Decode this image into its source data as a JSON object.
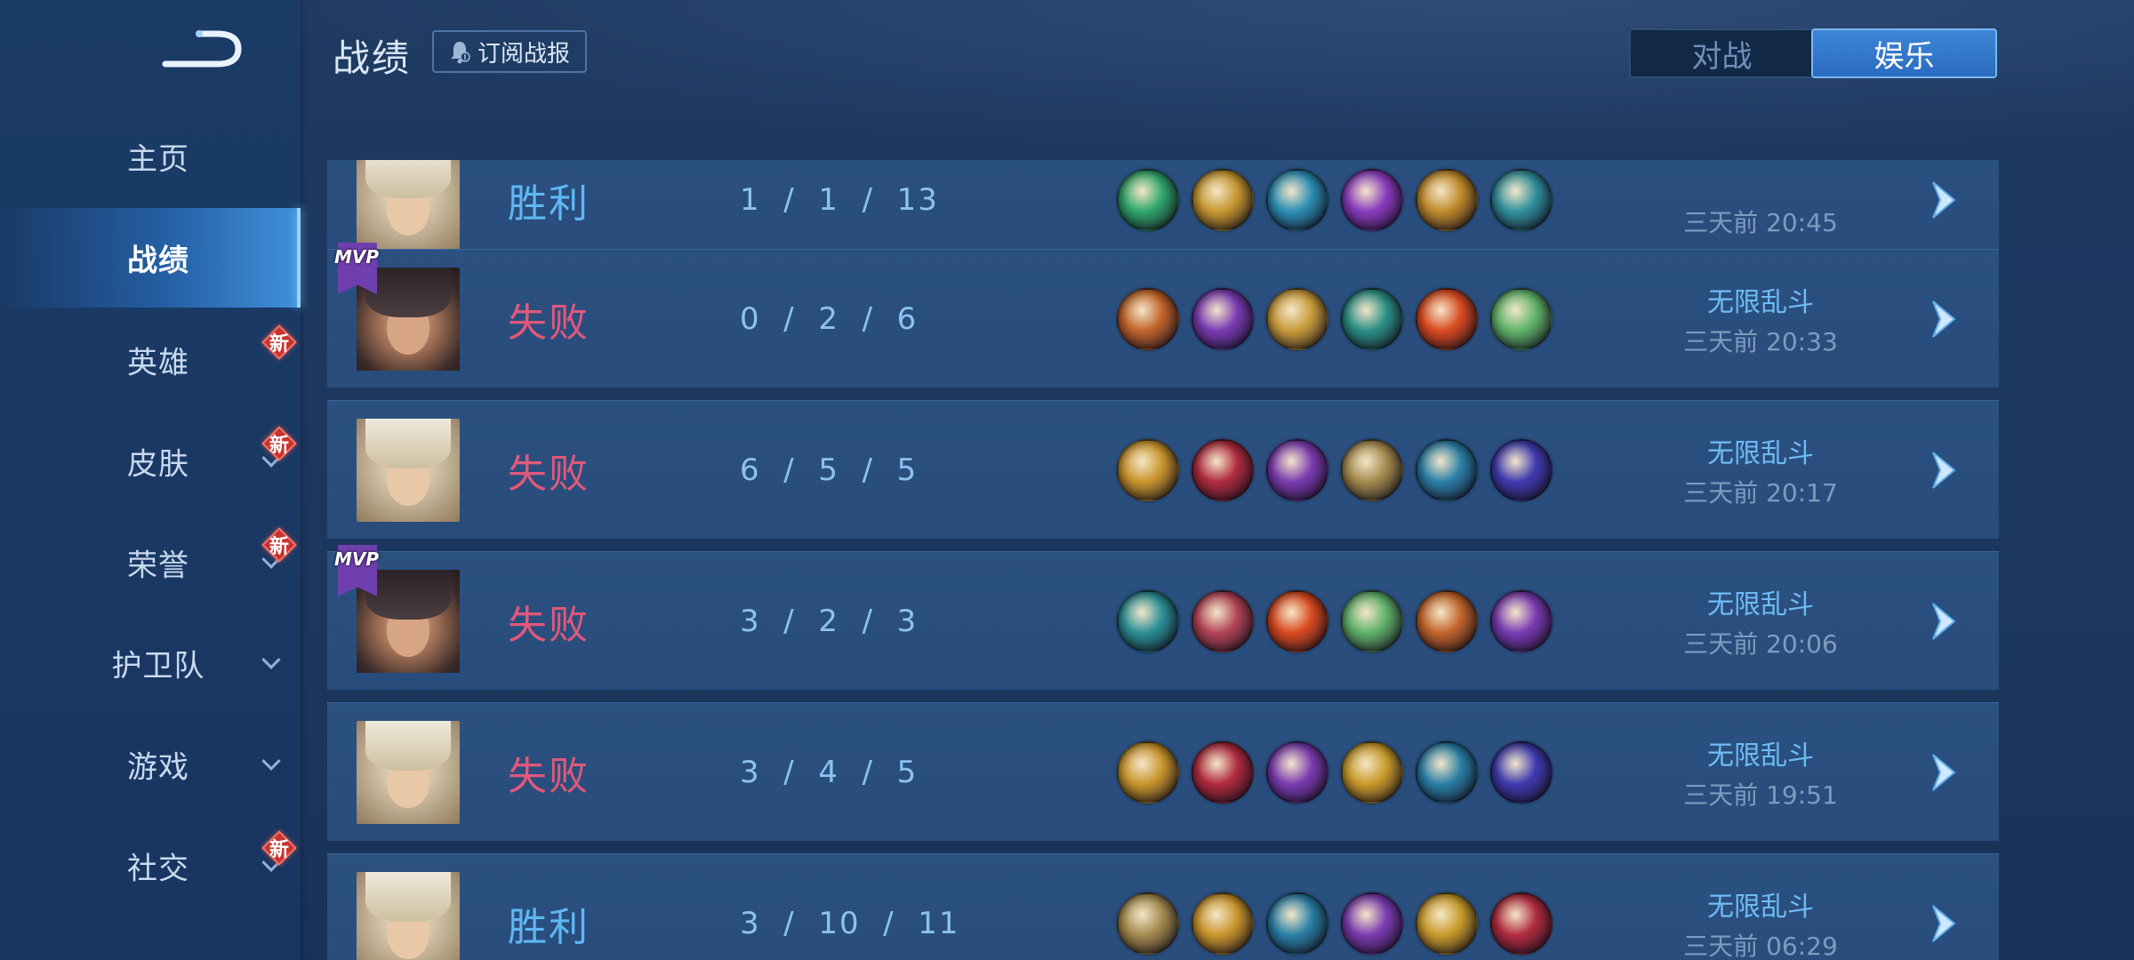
{
  "header": {
    "title": "战绩",
    "subscribe_label": "订阅战报",
    "toggle": [
      {
        "label": "对战",
        "active": false
      },
      {
        "label": "娱乐",
        "active": true
      }
    ]
  },
  "sidebar": {
    "items": [
      {
        "label": "主页",
        "active": false,
        "badge": "",
        "chevron": false
      },
      {
        "label": "战绩",
        "active": true,
        "badge": "",
        "chevron": false
      },
      {
        "label": "英雄",
        "active": false,
        "badge": "新",
        "chevron": false
      },
      {
        "label": "皮肤",
        "active": false,
        "badge": "新",
        "chevron": true
      },
      {
        "label": "荣誉",
        "active": false,
        "badge": "新",
        "chevron": true
      },
      {
        "label": "护卫队",
        "active": false,
        "badge": "",
        "chevron": true
      },
      {
        "label": "游戏",
        "active": false,
        "badge": "",
        "chevron": true
      },
      {
        "label": "社交",
        "active": false,
        "badge": "新",
        "chevron": true
      }
    ]
  },
  "matches": [
    {
      "result": "胜利",
      "outcome": "win",
      "kda": "1  /  1  /  13",
      "mode": "",
      "time": "三天前 20:45",
      "mvp": false,
      "hero": "blond",
      "items": [
        "#2fa66b",
        "#c6962f",
        "#2b8db4",
        "#8a3bbf",
        "#c08a2a",
        "#2f8f9c"
      ]
    },
    {
      "result": "失败",
      "outcome": "lose",
      "kda": "0  /  2  /  6",
      "mode": "无限乱斗",
      "time": "三天前 20:33",
      "mvp": true,
      "hero": "dark",
      "items": [
        "#c2642b",
        "#7a3bb3",
        "#c89a3a",
        "#2a8f86",
        "#d94a1f",
        "#5fb36a"
      ]
    },
    {
      "result": "失败",
      "outcome": "lose",
      "kda": "6  /  5  /  5",
      "mode": "无限乱斗",
      "time": "三天前 20:17",
      "mvp": false,
      "hero": "blond",
      "items": [
        "#c9952c",
        "#b02b3f",
        "#7b3bb0",
        "#a48a4e",
        "#2a7fa6",
        "#3f3bb0"
      ]
    },
    {
      "result": "失败",
      "outcome": "lose",
      "kda": "3  /  2  /  3",
      "mode": "无限乱斗",
      "time": "三天前 20:06",
      "mvp": true,
      "hero": "dark",
      "items": [
        "#2a8f96",
        "#b24456",
        "#d9491f",
        "#5fb06a",
        "#c2642b",
        "#7a3bb3"
      ]
    },
    {
      "result": "失败",
      "outcome": "lose",
      "kda": "3  /  4  /  5",
      "mode": "无限乱斗",
      "time": "三天前 19:51",
      "mvp": false,
      "hero": "blond",
      "items": [
        "#c9952c",
        "#b02b3f",
        "#7b3bb0",
        "#c89a2a",
        "#2a7fa6",
        "#3f3bb0"
      ]
    },
    {
      "result": "胜利",
      "outcome": "win",
      "kda": "3  /  10  /  11",
      "mode": "无限乱斗",
      "time": "三天前 06:29",
      "mvp": false,
      "hero": "blond",
      "items": [
        "#a48a4e",
        "#c9952c",
        "#2a7fa6",
        "#7b3bb0",
        "#c89a2a",
        "#b02b3f"
      ]
    }
  ]
}
